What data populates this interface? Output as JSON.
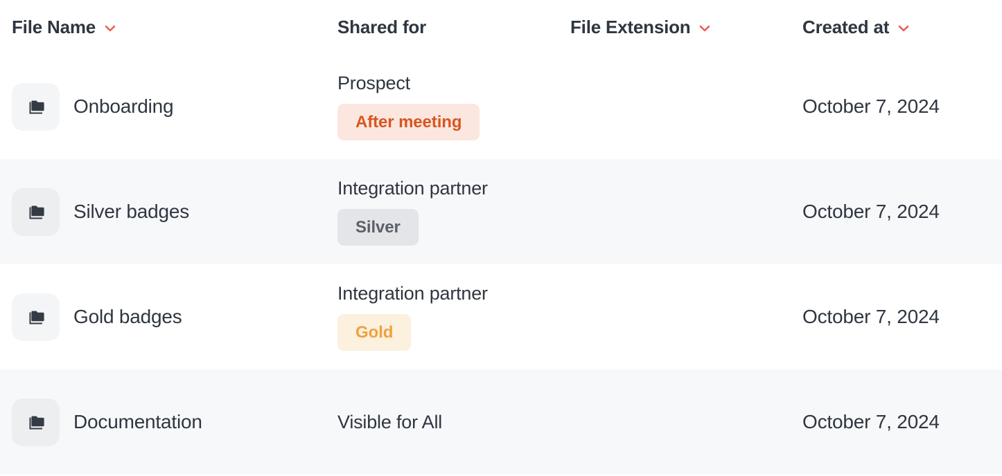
{
  "table": {
    "columns": [
      {
        "key": "file_name",
        "label": "File Name",
        "sortable": true,
        "sort_icon": "chevron-down-icon"
      },
      {
        "key": "shared_for",
        "label": "Shared for",
        "sortable": false,
        "sort_icon": ""
      },
      {
        "key": "file_extension",
        "label": "File Extension",
        "sortable": true,
        "sort_icon": "chevron-down-icon"
      },
      {
        "key": "created_at",
        "label": "Created at",
        "sortable": true,
        "sort_icon": "chevron-down-icon"
      }
    ],
    "rows": [
      {
        "icon": "folders-icon",
        "file_name": "Onboarding",
        "shared_for": "Prospect",
        "badge": {
          "label": "After meeting",
          "style": "after-meeting"
        },
        "file_extension": "",
        "created_at": "October 7, 2024",
        "striped": false
      },
      {
        "icon": "folders-icon",
        "file_name": "Silver badges",
        "shared_for": "Integration partner",
        "badge": {
          "label": "Silver",
          "style": "silver"
        },
        "file_extension": "",
        "created_at": "October 7, 2024",
        "striped": true
      },
      {
        "icon": "folders-icon",
        "file_name": "Gold badges",
        "shared_for": "Integration partner",
        "badge": {
          "label": "Gold",
          "style": "gold"
        },
        "file_extension": "",
        "created_at": "October 7, 2024",
        "striped": false
      },
      {
        "icon": "folders-icon",
        "file_name": "Documentation",
        "shared_for": "Visible for All",
        "badge": null,
        "file_extension": "",
        "created_at": "October 7, 2024",
        "striped": true
      }
    ]
  },
  "colors": {
    "text_primary": "#2f3640",
    "row_stripe": "#f7f8fa",
    "row_base": "#ffffff",
    "sort_chevron": "#ef5d52",
    "icon_tile": "#f4f5f6",
    "icon_tile_striped": "#eceef0",
    "badge_after_meeting_bg": "#fbe7df",
    "badge_after_meeting_fg": "#da5520",
    "badge_silver_bg": "#e3e5e8",
    "badge_silver_fg": "#5b6068",
    "badge_gold_bg": "#fcf0de",
    "badge_gold_fg": "#eda33c"
  }
}
